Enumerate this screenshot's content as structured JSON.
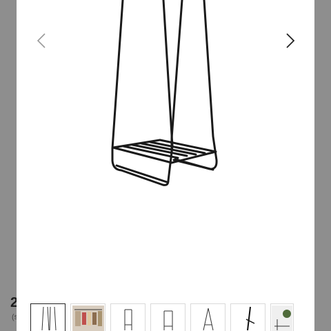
{
  "backdrop": {
    "leading_char": "2",
    "sub_char": "(s"
  },
  "gallery": {
    "prev_icon": "chevron-left-icon",
    "next_icon": "chevron-right-icon",
    "selected_index": 0,
    "thumbnails": [
      {
        "name": "thumb-rack-front",
        "icon": "clothes-rack-icon"
      },
      {
        "name": "thumb-rack-in-room",
        "icon": "room-photo-icon"
      },
      {
        "name": "thumb-rack-side",
        "icon": "clothes-rack-icon"
      },
      {
        "name": "thumb-rack-back",
        "icon": "clothes-rack-icon"
      },
      {
        "name": "thumb-rack-angle",
        "icon": "clothes-rack-icon"
      },
      {
        "name": "thumb-rack-detail",
        "icon": "rack-detail-icon"
      },
      {
        "name": "thumb-rack-plant",
        "icon": "room-photo-icon"
      }
    ]
  },
  "colors": {
    "backdrop": "#8e8e8e",
    "modal": "#ffffff",
    "rack": "#1a1a1a",
    "arrow": "#333333"
  }
}
